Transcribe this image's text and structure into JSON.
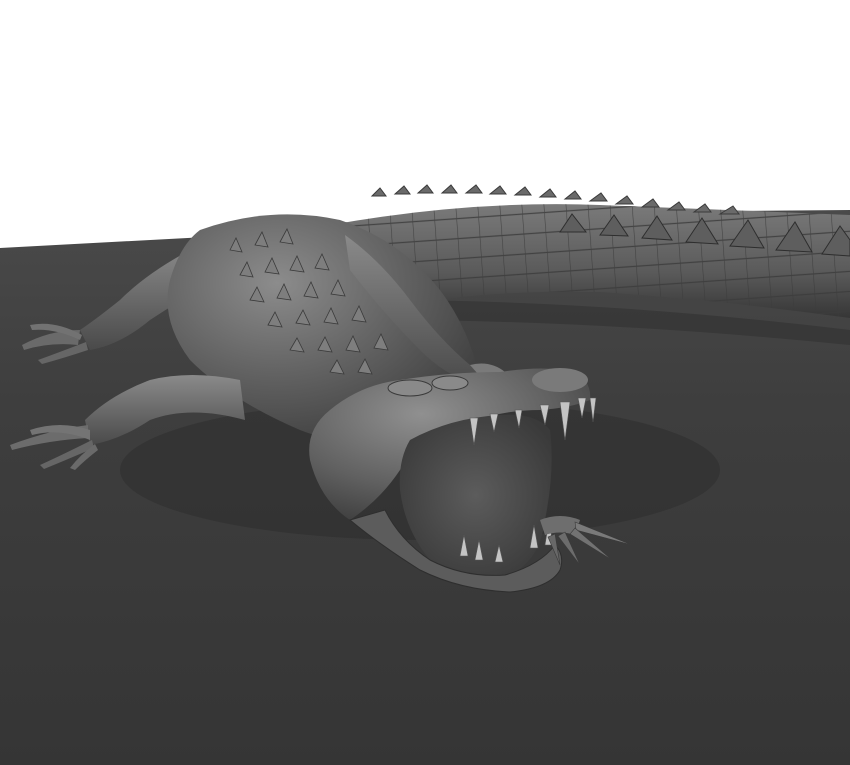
{
  "scene": {
    "subject": "crocodile-3d-render",
    "background_color": "#ffffff",
    "ground_color": "#3a3a3a",
    "ground_far_color": "#484848",
    "body_color": "#5a5a5a",
    "body_light_color": "#8a8a8a",
    "body_dark_color": "#2e2e2e",
    "mouth_inner_color": "#4a4a4a",
    "teeth_color": "#bdbdbd"
  }
}
